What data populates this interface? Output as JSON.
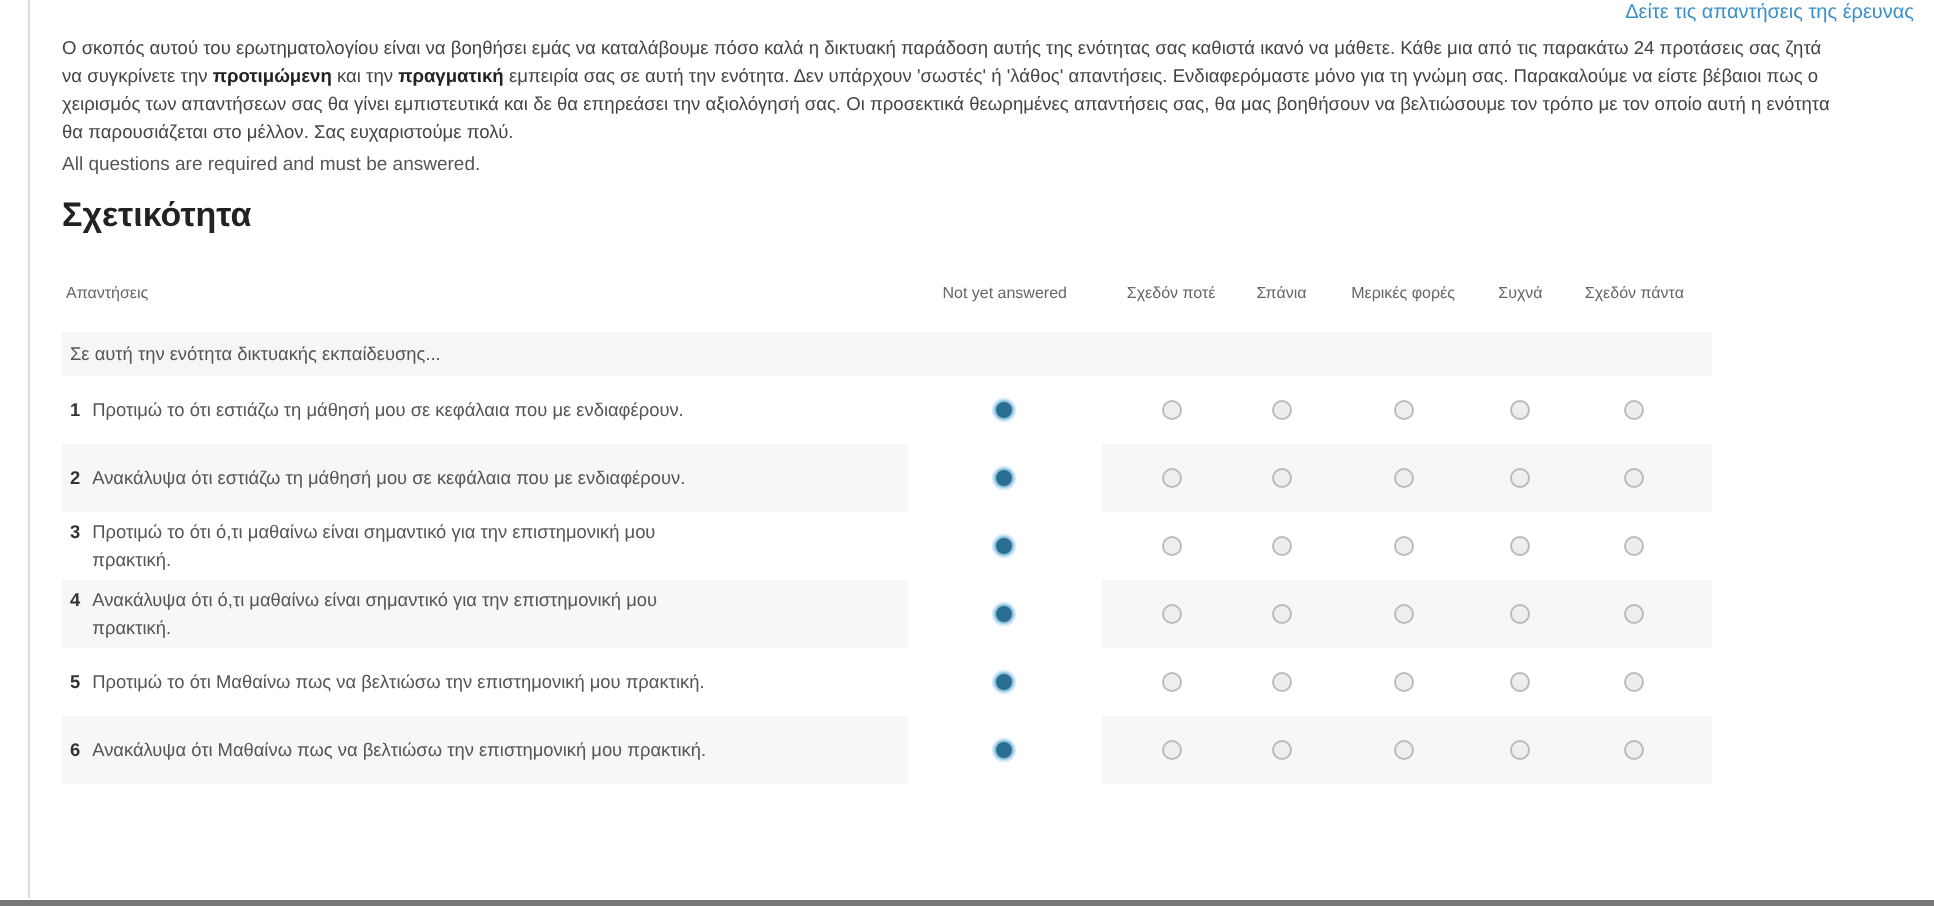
{
  "top_link": "Δείτε τις απαντήσεις της έρευνας",
  "intro": "Ο σκοπός αυτού του ερωτηματολογίου είναι να βοηθήσει εμάς να καταλάβουμε πόσο καλά η δικτυακή παράδοση αυτής της ενότητας σας καθιστά ικανό να μάθετε. Κάθε μια από τις παρακάτω 24 προτάσεις σας ζητά να συγκρίνετε την **προτιμώμενη** και την **πραγματική** εμπειρία σας σε αυτή την ενότητα. Δεν υπάρχουν 'σωστές' ή 'λάθος' απαντήσεις. Ενδιαφερόμαστε μόνο για τη γνώμη σας. Παρακαλούμε να είστε βέβαιοι πως ο χειρισμός των απαντήσεων σας θα γίνει εμπιστευτικά και δε θα επηρεάσει την αξιολόγησή σας. Οι προσεκτικά θεωρημένες απαντήσεις σας, θα μας βοηθήσουν να βελτιώσουμε τον τρόπο με τον οποίο αυτή η ενότητα θα παρουσιάζεται στο μέλλον. Σας ευχαριστούμε πολύ.",
  "required_note": "All questions are required and must be answered.",
  "section_title": "Σχετικότητα",
  "table": {
    "columns": [
      "Απαντήσεις",
      "Not yet answered",
      "Σχεδόν ποτέ",
      "Σπάνια",
      "Μερικές φορές",
      "Συχνά",
      "Σχεδόν πάντα"
    ],
    "group_label": "Σε αυτή την ενότητα δικτυακής εκπαίδευσης...",
    "rows": [
      {
        "number": "1",
        "text": "Προτιμώ το ότι   εστιάζω τη μάθησή μου σε κεφάλαια που με ενδιαφέρουν.",
        "choices": [
          {
            "selected": true
          },
          {
            "selected": false
          },
          {
            "selected": false
          },
          {
            "selected": false
          },
          {
            "selected": false
          },
          {
            "selected": false
          }
        ]
      },
      {
        "number": "2",
        "text": "Ανακάλυψα ότι   εστιάζω τη μάθησή μου σε κεφάλαια που με ενδιαφέρουν.",
        "choices": [
          {
            "selected": true
          },
          {
            "selected": false
          },
          {
            "selected": false
          },
          {
            "selected": false
          },
          {
            "selected": false
          },
          {
            "selected": false
          }
        ]
      },
      {
        "number": "3",
        "text": "Προτιμώ το ότι   ό,τι μαθαίνω είναι σημαντικό για την επιστημονική μου πρακτική.",
        "choices": [
          {
            "selected": true
          },
          {
            "selected": false
          },
          {
            "selected": false
          },
          {
            "selected": false
          },
          {
            "selected": false
          },
          {
            "selected": false
          }
        ]
      },
      {
        "number": "4",
        "text": "Ανακάλυψα ότι   ό,τι μαθαίνω είναι σημαντικό για την επιστημονική μου πρακτική.",
        "choices": [
          {
            "selected": true
          },
          {
            "selected": false
          },
          {
            "selected": false
          },
          {
            "selected": false
          },
          {
            "selected": false
          },
          {
            "selected": false
          }
        ]
      },
      {
        "number": "5",
        "text": "Προτιμώ το ότι   Μαθαίνω πως να βελτιώσω την επιστημονική μου πρακτική.",
        "choices": [
          {
            "selected": true
          },
          {
            "selected": false
          },
          {
            "selected": false
          },
          {
            "selected": false
          },
          {
            "selected": false
          },
          {
            "selected": false
          }
        ]
      },
      {
        "number": "6",
        "text": "Ανακάλυψα ότι   Μαθαίνω πως να βελτιώσω την επιστημονική μου πρακτική.",
        "choices": [
          {
            "selected": true
          },
          {
            "selected": false
          },
          {
            "selected": false
          },
          {
            "selected": false
          },
          {
            "selected": false
          },
          {
            "selected": false
          }
        ]
      }
    ]
  }
}
